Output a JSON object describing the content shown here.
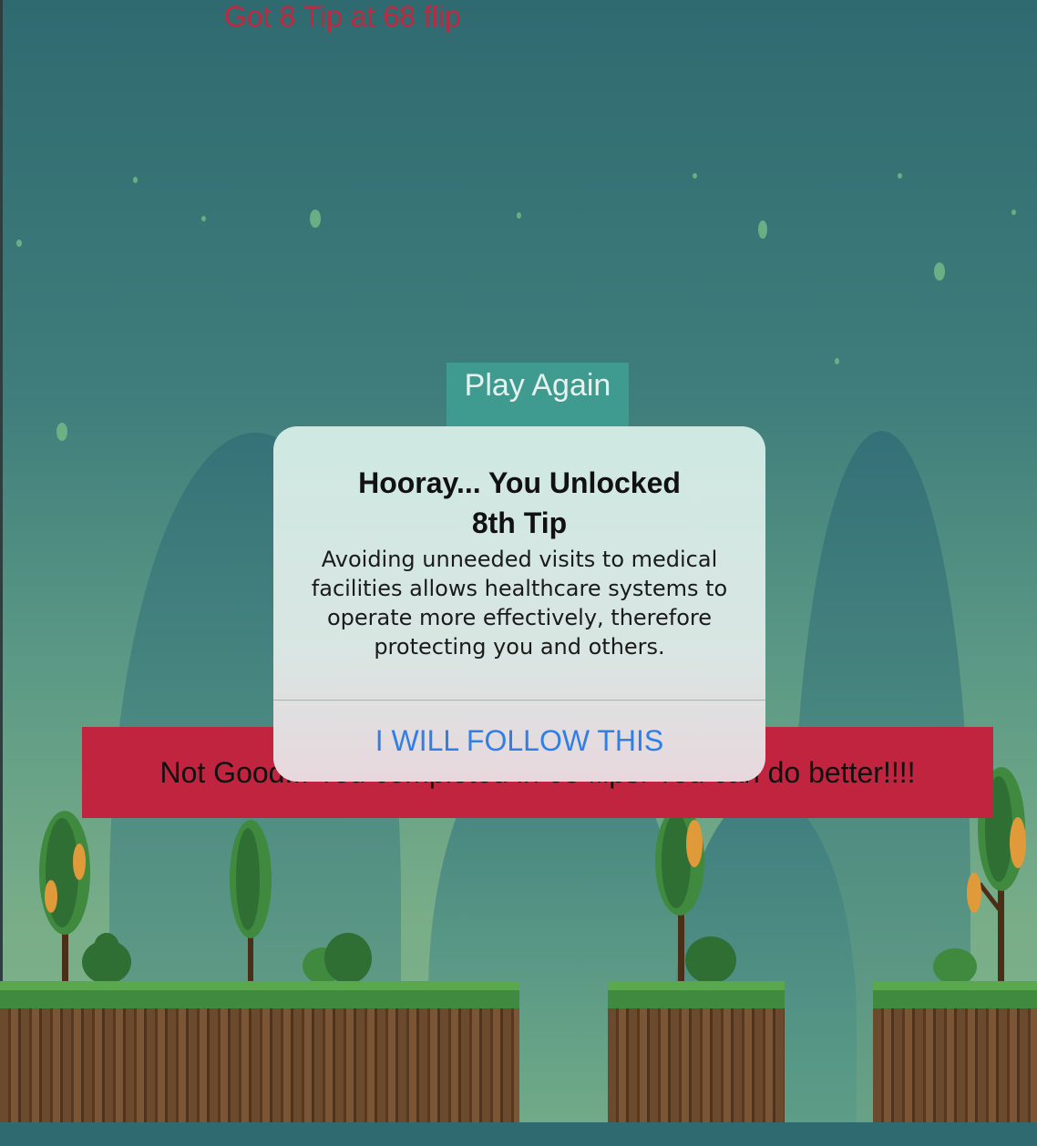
{
  "header": {
    "tip_status": "Got 8 Tip at 68 flip"
  },
  "play_again": {
    "label": "Play Again"
  },
  "result_banner": {
    "text": "Not Good!!! You completed in 68 flips. You can do better!!!!"
  },
  "alert": {
    "title_line1": "Hooray... You Unlocked",
    "title_line2": "8th Tip",
    "message": "Avoiding unneeded visits to medical facilities allows healthcare systems to operate more effectively, therefore protecting you and others.",
    "button_label": "I WILL FOLLOW THIS",
    "accent_color": "#2f7fe6"
  },
  "colors": {
    "sky": "#2f6a70",
    "banner": "#c0243f",
    "tip_text": "#c0283f",
    "play_again_bg": "#3f9a90"
  }
}
